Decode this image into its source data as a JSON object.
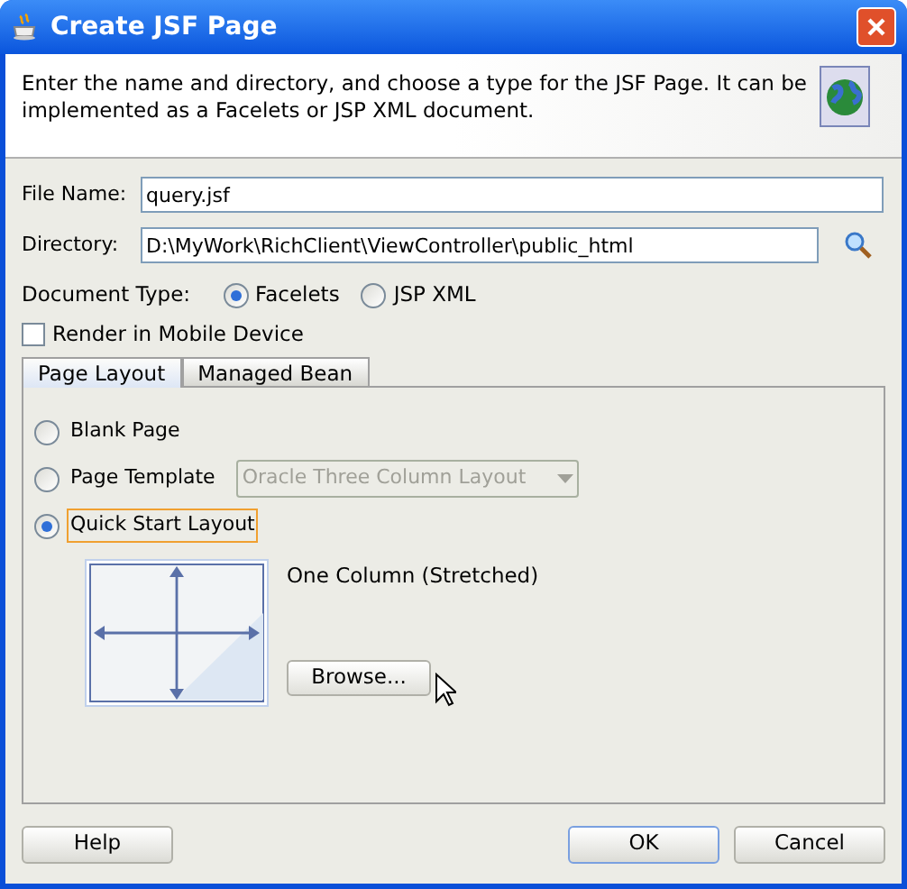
{
  "window": {
    "title": "Create JSF Page"
  },
  "header": {
    "description": "Enter the name and directory, and choose a type for the JSF Page. It can be implemented as a Facelets or JSP XML document."
  },
  "fields": [
    {
      "label": "File Name:",
      "value": "query.jsf",
      "kind": "text"
    },
    {
      "label": "Directory:",
      "value": "D:\\MyWork\\RichClient\\ViewController\\public_html",
      "kind": "browse"
    }
  ],
  "document_type": {
    "label": "Document Type:",
    "options": [
      {
        "label": "Facelets",
        "selected": true
      },
      {
        "label": "JSP XML",
        "selected": false
      }
    ]
  },
  "render_mobile": {
    "label": "Render in Mobile Device",
    "checked": false
  },
  "tabs": [
    {
      "label": "Page Layout",
      "selected": true
    },
    {
      "label": "Managed Bean",
      "selected": false
    }
  ],
  "layout_options": [
    {
      "label": "Blank Page",
      "selected": false,
      "kind": "plain",
      "focused": false
    },
    {
      "label": "Page Template",
      "selected": false,
      "kind": "dropdown",
      "focused": false,
      "dropdown": {
        "value": "Oracle Three Column Layout",
        "disabled": true
      }
    },
    {
      "label": "Quick Start Layout",
      "selected": true,
      "kind": "plain",
      "focused": true
    }
  ],
  "preview": {
    "caption": "One Column (Stretched)",
    "browse_button": "Browse..."
  },
  "buttons": [
    {
      "label": "Help",
      "default": false
    },
    {
      "label": "OK",
      "default": true
    },
    {
      "label": "Cancel",
      "default": false
    }
  ]
}
